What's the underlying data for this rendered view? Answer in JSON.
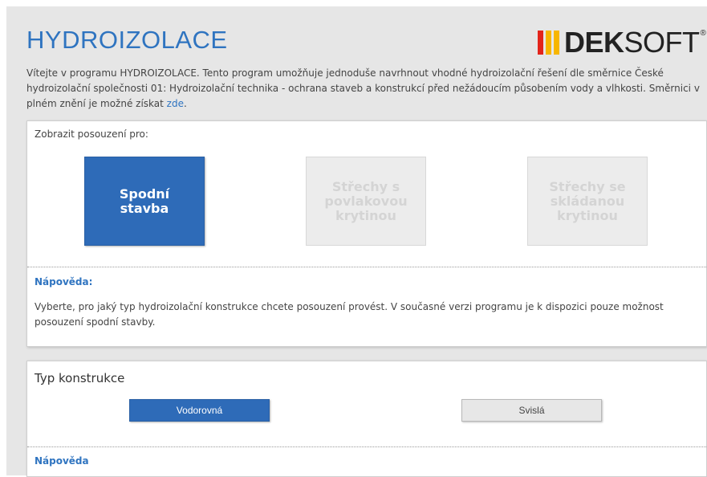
{
  "header": {
    "app_title": "HYDROIZOLACE",
    "logo": {
      "text_bold": "DEK",
      "text_regular": "SOFT",
      "registered_mark": "®",
      "bar_colors": [
        "#e3241b",
        "#f7b600",
        "#f7b600"
      ]
    }
  },
  "intro": {
    "text": "Vítejte v programu HYDROIZOLACE. Tento program umožňuje jednoduše navrhnout vhodné hydroizolační řešení dle směrnice České hydroizolační společnosti 01: Hydroizolační technika - ochrana staveb a konstrukcí před nežádoucím působením vody a vlhkosti. Směrnici v plném znění je možné získat ",
    "link_text": "zde",
    "trailing": "."
  },
  "posouzeni": {
    "label": "Zobrazit posouzení pro:",
    "options": [
      {
        "label": "Spodní\nstavba",
        "state": "active"
      },
      {
        "label": "Střechy s\npovlakovou\nkrytinou",
        "state": "disabled"
      },
      {
        "label": "Střechy se\nskládanou\nkrytinou",
        "state": "disabled"
      }
    ],
    "help_title": "Nápověda:",
    "help_text": "Vyberte, pro jaký typ hydroizolační konstrukce chcete posouzení provést. V současné verzi programu je k dispozici pouze možnost posouzení spodní stavby."
  },
  "typ_konstrukce": {
    "title": "Typ konstrukce",
    "options": [
      {
        "label": "Vodorovná",
        "state": "active"
      },
      {
        "label": "Svislá",
        "state": "inactive"
      }
    ],
    "help_title": "Nápověda"
  },
  "colors": {
    "accent": "#2f74c0",
    "active_button": "#2e6bb8",
    "disabled_tile": "#ececec",
    "page_background": "#e6e6e6"
  }
}
